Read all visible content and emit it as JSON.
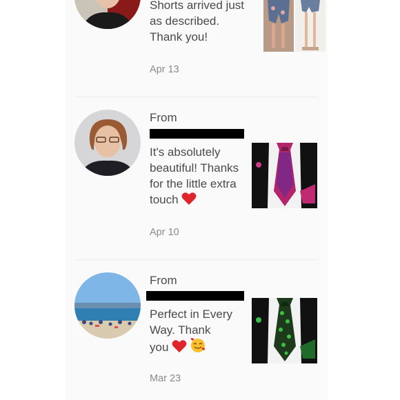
{
  "reviews": [
    {
      "message": "Shorts arrived just as described. Thank you!",
      "date": "Apr 13",
      "avatar": "reviewer-avatar-dark-hair",
      "item": "floral-shorts-thumbnail"
    },
    {
      "from_label": "From",
      "message": "It's absolutely beautiful! Thanks for the little extra touch",
      "emoji": "red-heart",
      "date": "Apr 10",
      "avatar": "reviewer-avatar-glasses",
      "item": "pink-paisley-tie-thumbnail"
    },
    {
      "from_label": "From",
      "message": "Perfect in Every Way. Thank you",
      "emoji": "red-heart",
      "emoji2": "smiling-face-with-hearts",
      "date": "Mar 23",
      "avatar": "beach-avatar",
      "item": "green-floral-tie-thumbnail"
    }
  ],
  "colors": {
    "panel_bg": "#fafafa",
    "text": "#4a4a4a",
    "date_text": "#8a8a8a",
    "heart": "#e0242b"
  }
}
